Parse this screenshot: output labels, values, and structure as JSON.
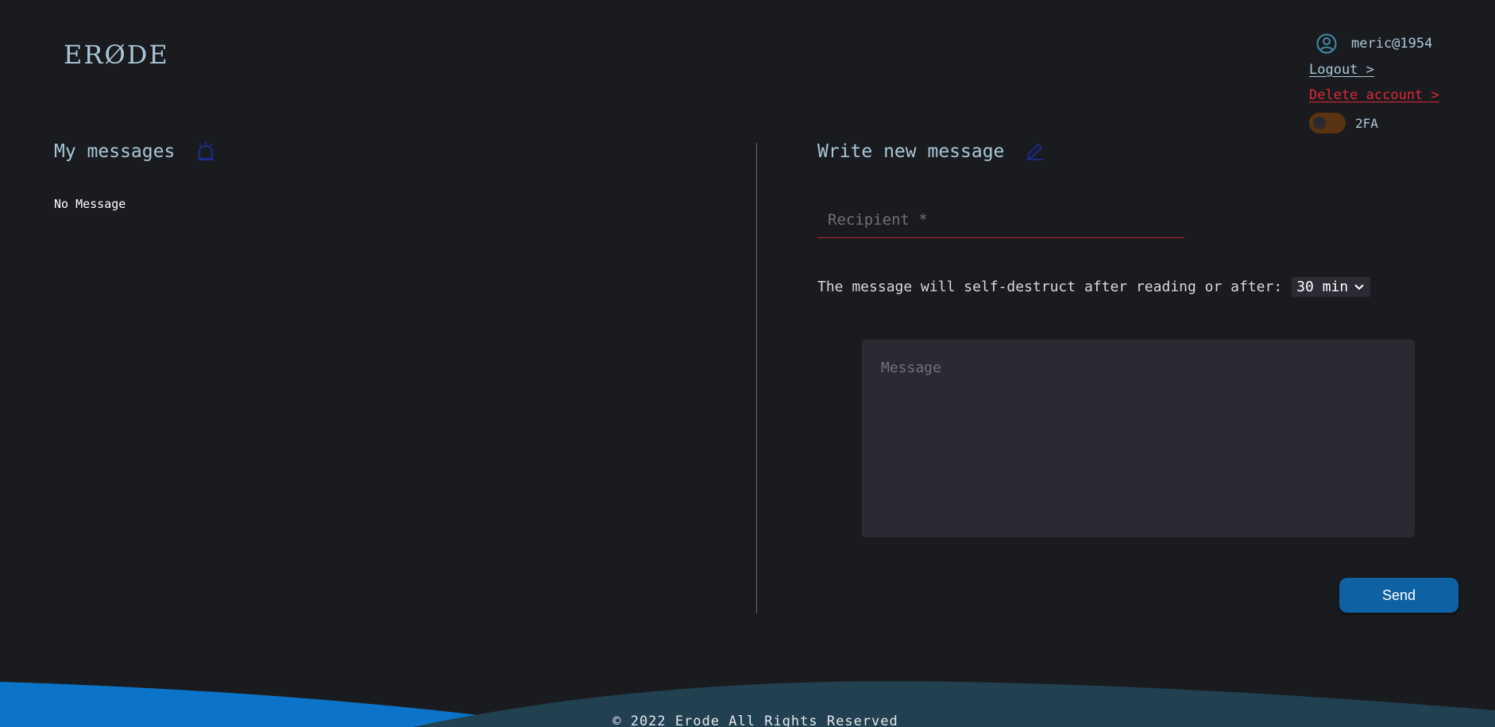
{
  "brand": {
    "logo_text": "ERØDE"
  },
  "user": {
    "icon": "user-icon",
    "username": "meric@1954",
    "logout_label": "Logout >",
    "delete_label": "Delete account >",
    "twofa_label": "2FA",
    "twofa_enabled": false
  },
  "messages": {
    "title": "My messages",
    "icon": "alarm-icon",
    "empty_text": "No Message"
  },
  "compose": {
    "title": "Write new message",
    "icon": "pencil-icon",
    "recipient_placeholder": "Recipient *",
    "destruct_text": "The message will self-destruct after reading or after:",
    "destruct_value": "30 min",
    "message_placeholder": "Message",
    "send_label": "Send"
  },
  "footer": {
    "copyright": "© 2022 Erode All Rights Reserved"
  },
  "colors": {
    "background": "#1a1b1e",
    "accent_text": "#a9c6d8",
    "danger": "#e0283a",
    "button": "#0e62a3",
    "wave_light": "#0c74c8",
    "wave_dark": "#214150"
  }
}
